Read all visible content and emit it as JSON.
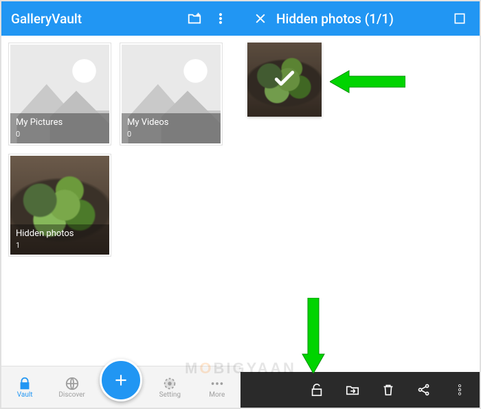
{
  "colors": {
    "primary": "#2196F3",
    "arrow": "#00D400"
  },
  "left": {
    "app_title": "GalleryVault",
    "folders": [
      {
        "name": "My Pictures",
        "count": "0",
        "thumb": "empty"
      },
      {
        "name": "My Videos",
        "count": "0",
        "thumb": "empty"
      },
      {
        "name": "Hidden photos",
        "count": "1",
        "thumb": "plants"
      }
    ],
    "nav": {
      "vault": "Vault",
      "discover": "Discover",
      "setting": "Setting",
      "more": "More"
    }
  },
  "right": {
    "title": "Hidden photos (1/1)",
    "photo_selected": true,
    "actions": {
      "unlock": "unlock-icon",
      "move": "move-folder-icon",
      "delete": "trash-icon",
      "share": "share-icon",
      "overflow": "more-icon"
    }
  },
  "watermark": "MOBIGYAAN"
}
